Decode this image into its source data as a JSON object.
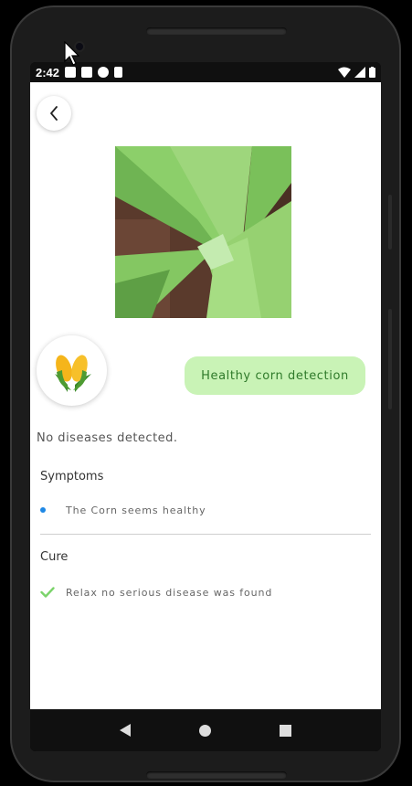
{
  "status_bar": {
    "time": "2:42"
  },
  "header": {
    "back_icon": "chevron-left-icon"
  },
  "detection": {
    "result_label": "Healthy corn detection",
    "summary": "No diseases detected.",
    "crop_icon": "corn-icon"
  },
  "symptoms": {
    "title": "Symptoms",
    "items": [
      "The Corn seems healthy"
    ],
    "bullet_color": "#1e88e5"
  },
  "cure": {
    "title": "Cure",
    "items": [
      "Relax no serious disease was found"
    ],
    "check_color": "#7bd36b"
  },
  "colors": {
    "pill_background": "#c9f3b6",
    "pill_text": "#2f7a2a"
  }
}
